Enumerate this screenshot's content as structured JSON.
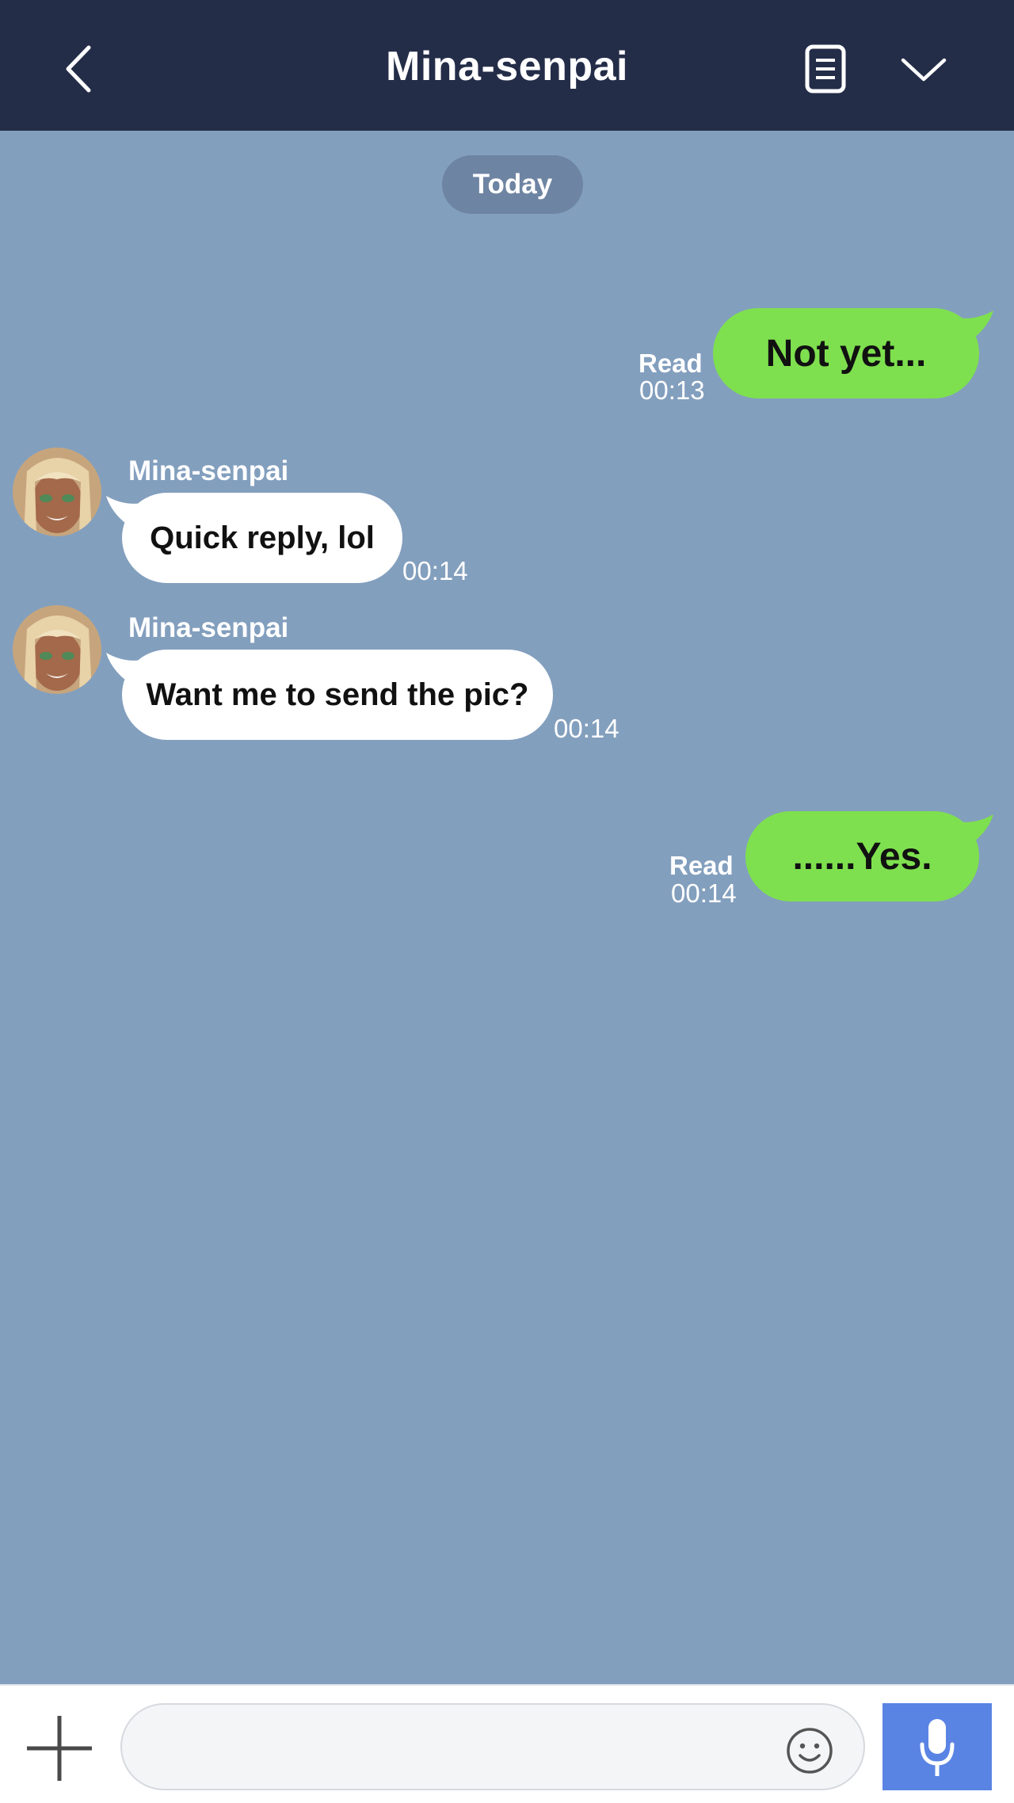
{
  "header": {
    "title": "Mina-senpai",
    "back_icon": "chevron-left-icon",
    "notes_icon": "notes-icon",
    "menu_icon": "chevron-down-icon"
  },
  "date_separator": "Today",
  "messages": [
    {
      "from": "me",
      "text": "Not yet...",
      "read_label": "Read",
      "time": "00:13"
    },
    {
      "from": "them",
      "sender": "Mina-senpai",
      "text": "Quick reply, lol",
      "time": "00:14"
    },
    {
      "from": "them",
      "sender": "Mina-senpai",
      "text": "Want me to send the pic?",
      "time": "00:14"
    },
    {
      "from": "me",
      "text": "......Yes.",
      "read_label": "Read",
      "time": "00:14"
    }
  ],
  "composer": {
    "placeholder": "",
    "plus_icon": "plus-icon",
    "emoji_icon": "smiley-icon",
    "mic_icon": "microphone-icon"
  },
  "colors": {
    "header_bg": "#242d48",
    "chat_bg": "#839fbe",
    "my_bubble": "#7ee04e",
    "their_bubble": "#ffffff",
    "date_pill": "#6e84a3",
    "mic_button": "#5a84e4"
  }
}
